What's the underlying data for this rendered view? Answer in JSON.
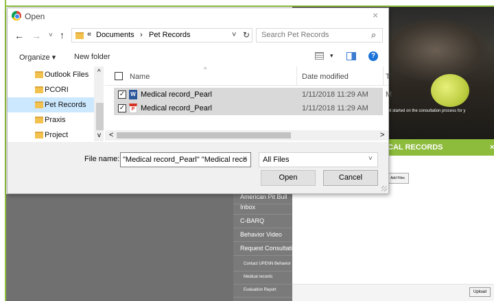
{
  "background": {
    "menu_items": [
      "American Pit Bull",
      "Inbox",
      "C-BARQ",
      "Behavior Video",
      "Request Consultation"
    ],
    "submenu_items": [
      "Contact UPENN Behavior",
      "Medical records",
      "Evaluation Report"
    ],
    "photo_caption": "get started on the consultation process for y",
    "panel_title": "CAL RECORDS",
    "panel_close": "×",
    "add_files": "Add Files",
    "upload": "Upload",
    "colors": {
      "accent": "#8dbb3c",
      "menu_bg": "#7a7a7a"
    }
  },
  "dialog": {
    "title": "Open",
    "close_icon": "×",
    "nav": {
      "back": "←",
      "forward": "→",
      "dropdown": "˅",
      "up": "↑"
    },
    "address": {
      "chevron": "«",
      "parts": [
        "Documents",
        "Pet Records"
      ],
      "separator": "›",
      "dropdown": "˅",
      "refresh": "↻"
    },
    "search": {
      "placeholder": "Search Pet Records",
      "icon": "⌕"
    },
    "toolbar": {
      "organize": "Organize ▾",
      "new_folder": "New folder",
      "view_dropdown": "▾",
      "help": "?"
    },
    "sidebar": {
      "items": [
        {
          "label": "Outlook Files",
          "selected": false
        },
        {
          "label": "PCORI",
          "selected": false
        },
        {
          "label": "Pet Records",
          "selected": true
        },
        {
          "label": "Praxis",
          "selected": false
        },
        {
          "label": "Project Destine",
          "selected": false
        }
      ],
      "scroll_up": "^",
      "scroll_down": "v"
    },
    "list": {
      "columns": {
        "name": "Name",
        "date": "Date modified",
        "extra": "T"
      },
      "sort_indicator": "^",
      "files": [
        {
          "name": "Medical record_Pearl",
          "date": "1/11/2018 11:29 AM",
          "type_icon": "word-doc-icon",
          "checked": true,
          "badge": "W",
          "extra": "M"
        },
        {
          "name": "Medical record_Pearl",
          "date": "1/11/2018 11:29 AM",
          "type_icon": "pdf-icon",
          "checked": true,
          "badge": "P",
          "extra": ""
        }
      ],
      "checkmark": "✓",
      "hscroll_left": "<",
      "hscroll_right": ">"
    },
    "file_name_label": "File name:",
    "file_name_value": "\"Medical record_Pearl\" \"Medical reco",
    "file_name_dropdown": "˅",
    "file_type": "All Files",
    "file_type_dropdown": "˅",
    "open_button": "Open",
    "cancel_button": "Cancel"
  }
}
